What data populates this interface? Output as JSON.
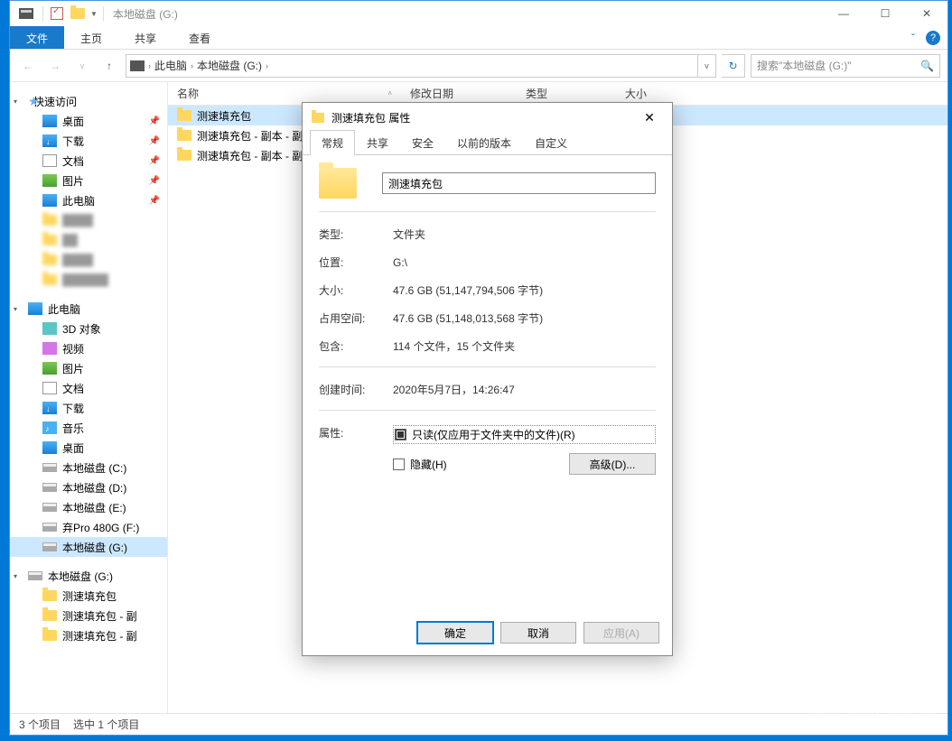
{
  "window": {
    "title": "本地磁盘 (G:)"
  },
  "ribbon": {
    "file": "文件",
    "home": "主页",
    "share": "共享",
    "view": "查看"
  },
  "breadcrumb": {
    "thispc": "此电脑",
    "drive": "本地磁盘 (G:)"
  },
  "search": {
    "placeholder": "搜索\"本地磁盘 (G:)\""
  },
  "columns": {
    "name": "名称",
    "date": "修改日期",
    "type": "类型",
    "size": "大小"
  },
  "nav": {
    "quick": "快速访问",
    "desktop": "桌面",
    "downloads": "下载",
    "documents": "文档",
    "pictures": "图片",
    "thispc": "此电脑",
    "thispc2": "此电脑",
    "obj3d": "3D 对象",
    "video": "视频",
    "pictures2": "图片",
    "documents2": "文档",
    "downloads2": "下载",
    "music": "音乐",
    "desktop2": "桌面",
    "drivec": "本地磁盘 (C:)",
    "drived": "本地磁盘 (D:)",
    "drivee": "本地磁盘 (E:)",
    "drivef": "弃Pro 480G (F:)",
    "driveg": "本地磁盘 (G:)",
    "driveg2": "本地磁盘 (G:)",
    "folder1": "测速填充包",
    "folder2": "测速填充包 - 副",
    "folder3": "测速填充包 - 副"
  },
  "files": {
    "f1": "测速填充包",
    "f2": "测速填充包 - 副本 - 副本",
    "f3": "测速填充包 - 副本 - 副本 (2)"
  },
  "status": {
    "count": "3 个项目",
    "selected": "选中 1 个项目"
  },
  "dialog": {
    "title": "测速填充包 属性",
    "tabs": {
      "general": "常规",
      "share": "共享",
      "security": "安全",
      "prev": "以前的版本",
      "custom": "自定义"
    },
    "name": "测速填充包",
    "labels": {
      "type": "类型:",
      "location": "位置:",
      "size": "大小:",
      "diskspace": "占用空间:",
      "contains": "包含:",
      "created": "创建时间:",
      "attrs": "属性:"
    },
    "vals": {
      "type": "文件夹",
      "location": "G:\\",
      "size": "47.6 GB (51,147,794,506 字节)",
      "diskspace": "47.6 GB (51,148,013,568 字节)",
      "contains": "114 个文件，15 个文件夹",
      "created": "2020年5月7日，14:26:47"
    },
    "readonly": "只读(仅应用于文件夹中的文件)(R)",
    "hidden": "隐藏(H)",
    "advanced": "高级(D)...",
    "ok": "确定",
    "cancel": "取消",
    "apply": "应用(A)"
  },
  "watermark": "值 | 什么值得买"
}
